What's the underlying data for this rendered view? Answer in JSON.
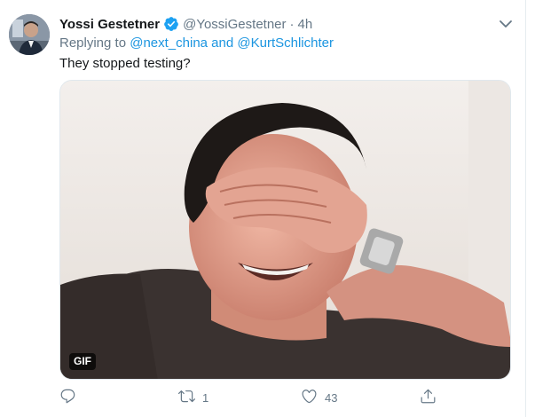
{
  "tweet": {
    "display_name": "Yossi Gestetner",
    "handle": "@YossiGestetner",
    "separator": "·",
    "time": "4h",
    "replying_to_prefix": "Replying to",
    "mention_1": "@next_china",
    "and_text": "and",
    "mention_2": "@KurtSchlichter",
    "text": "They stopped testing?",
    "media_badge": "GIF",
    "actions": {
      "reply_icon": "reply-icon",
      "retweet_icon": "retweet-icon",
      "retweet_count": "1",
      "like_icon": "heart-icon",
      "like_count": "43",
      "share_icon": "share-icon"
    }
  },
  "colors": {
    "link": "#1b95e0",
    "verified": "#1da1f2",
    "muted": "#657786",
    "text": "#14171a"
  }
}
